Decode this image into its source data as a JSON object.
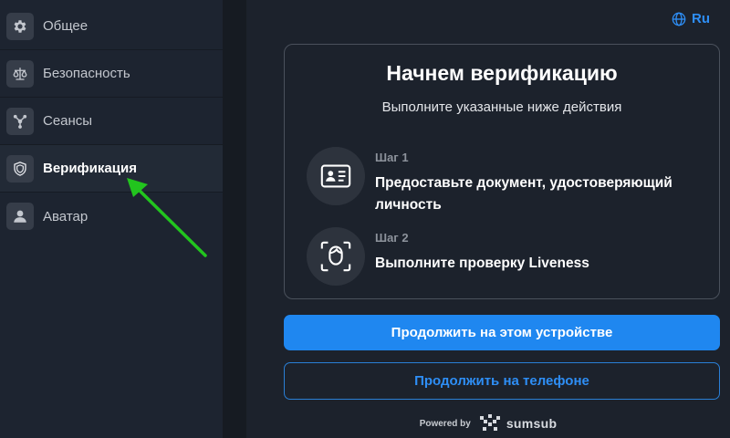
{
  "sidebar": {
    "items": [
      {
        "label": "Общее",
        "icon": "gear-icon"
      },
      {
        "label": "Безопасность",
        "icon": "scales-icon"
      },
      {
        "label": "Сеансы",
        "icon": "network-icon"
      },
      {
        "label": "Верификация",
        "icon": "shield-check-icon",
        "active": true
      },
      {
        "label": "Аватар",
        "icon": "user-icon"
      }
    ]
  },
  "language": {
    "label": "Ru",
    "icon": "globe-icon"
  },
  "verification": {
    "title": "Начнем верификацию",
    "subtitle": "Выполните указанные ниже действия",
    "steps": [
      {
        "number": "Шаг 1",
        "description": "Предоставьте документ, удостоверяющий личность",
        "icon": "id-card-icon"
      },
      {
        "number": "Шаг 2",
        "description": "Выполните проверку Liveness",
        "icon": "face-scan-icon"
      }
    ]
  },
  "buttons": {
    "primary": "Продолжить на этом устройстве",
    "secondary": "Продолжить на телефоне"
  },
  "footer": {
    "powered_by": "Powered by",
    "brand": "sumsub"
  },
  "colors": {
    "accent": "#1f87f0",
    "link": "#2e8ef5",
    "annotation_arrow": "#22c41e"
  }
}
